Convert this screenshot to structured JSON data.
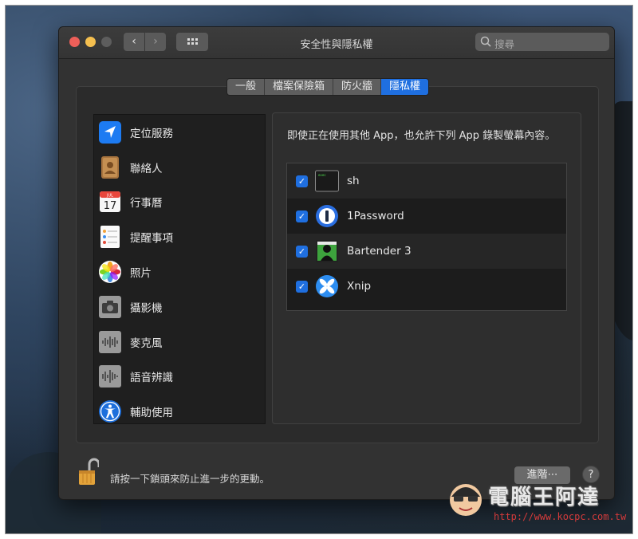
{
  "window": {
    "title": "安全性與隱私權",
    "search_placeholder": "搜尋"
  },
  "tabs": [
    {
      "label": "一般",
      "active": false
    },
    {
      "label": "檔案保險箱",
      "active": false
    },
    {
      "label": "防火牆",
      "active": false
    },
    {
      "label": "隱私權",
      "active": true
    }
  ],
  "sidebar": {
    "items": [
      {
        "label": "定位服務",
        "icon": "location-arrow-icon"
      },
      {
        "label": "聯絡人",
        "icon": "contacts-icon"
      },
      {
        "label": "行事曆",
        "icon": "calendar-icon",
        "icon_month": "JUL",
        "icon_day": "17"
      },
      {
        "label": "提醒事項",
        "icon": "reminders-icon"
      },
      {
        "label": "照片",
        "icon": "photos-icon"
      },
      {
        "label": "攝影機",
        "icon": "camera-icon"
      },
      {
        "label": "麥克風",
        "icon": "microphone-icon"
      },
      {
        "label": "語音辨識",
        "icon": "speech-recognition-icon"
      },
      {
        "label": "輔助使用",
        "icon": "accessibility-icon"
      }
    ]
  },
  "content": {
    "description": "即使正在使用其他 App，也允許下列 App 錄製螢幕內容。",
    "apps": [
      {
        "name": "sh",
        "checked": true,
        "icon": "terminal-icon",
        "icon_text": "exec"
      },
      {
        "name": "1Password",
        "checked": true,
        "icon": "1password-icon"
      },
      {
        "name": "Bartender 3",
        "checked": true,
        "icon": "bartender-icon"
      },
      {
        "name": "Xnip",
        "checked": true,
        "icon": "xnip-icon"
      }
    ]
  },
  "footer": {
    "lock_text": "請按一下鎖頭來防止進一步的更動。",
    "advanced_label": "進階⋯",
    "help_label": "?"
  },
  "watermark": {
    "text": "電腦王阿達",
    "url": "http://www.kocpc.com.tw"
  },
  "colors": {
    "accent": "#1f6fe0",
    "window_bg": "#323232",
    "close": "#ed5f59",
    "minimize": "#f4bf4f"
  }
}
